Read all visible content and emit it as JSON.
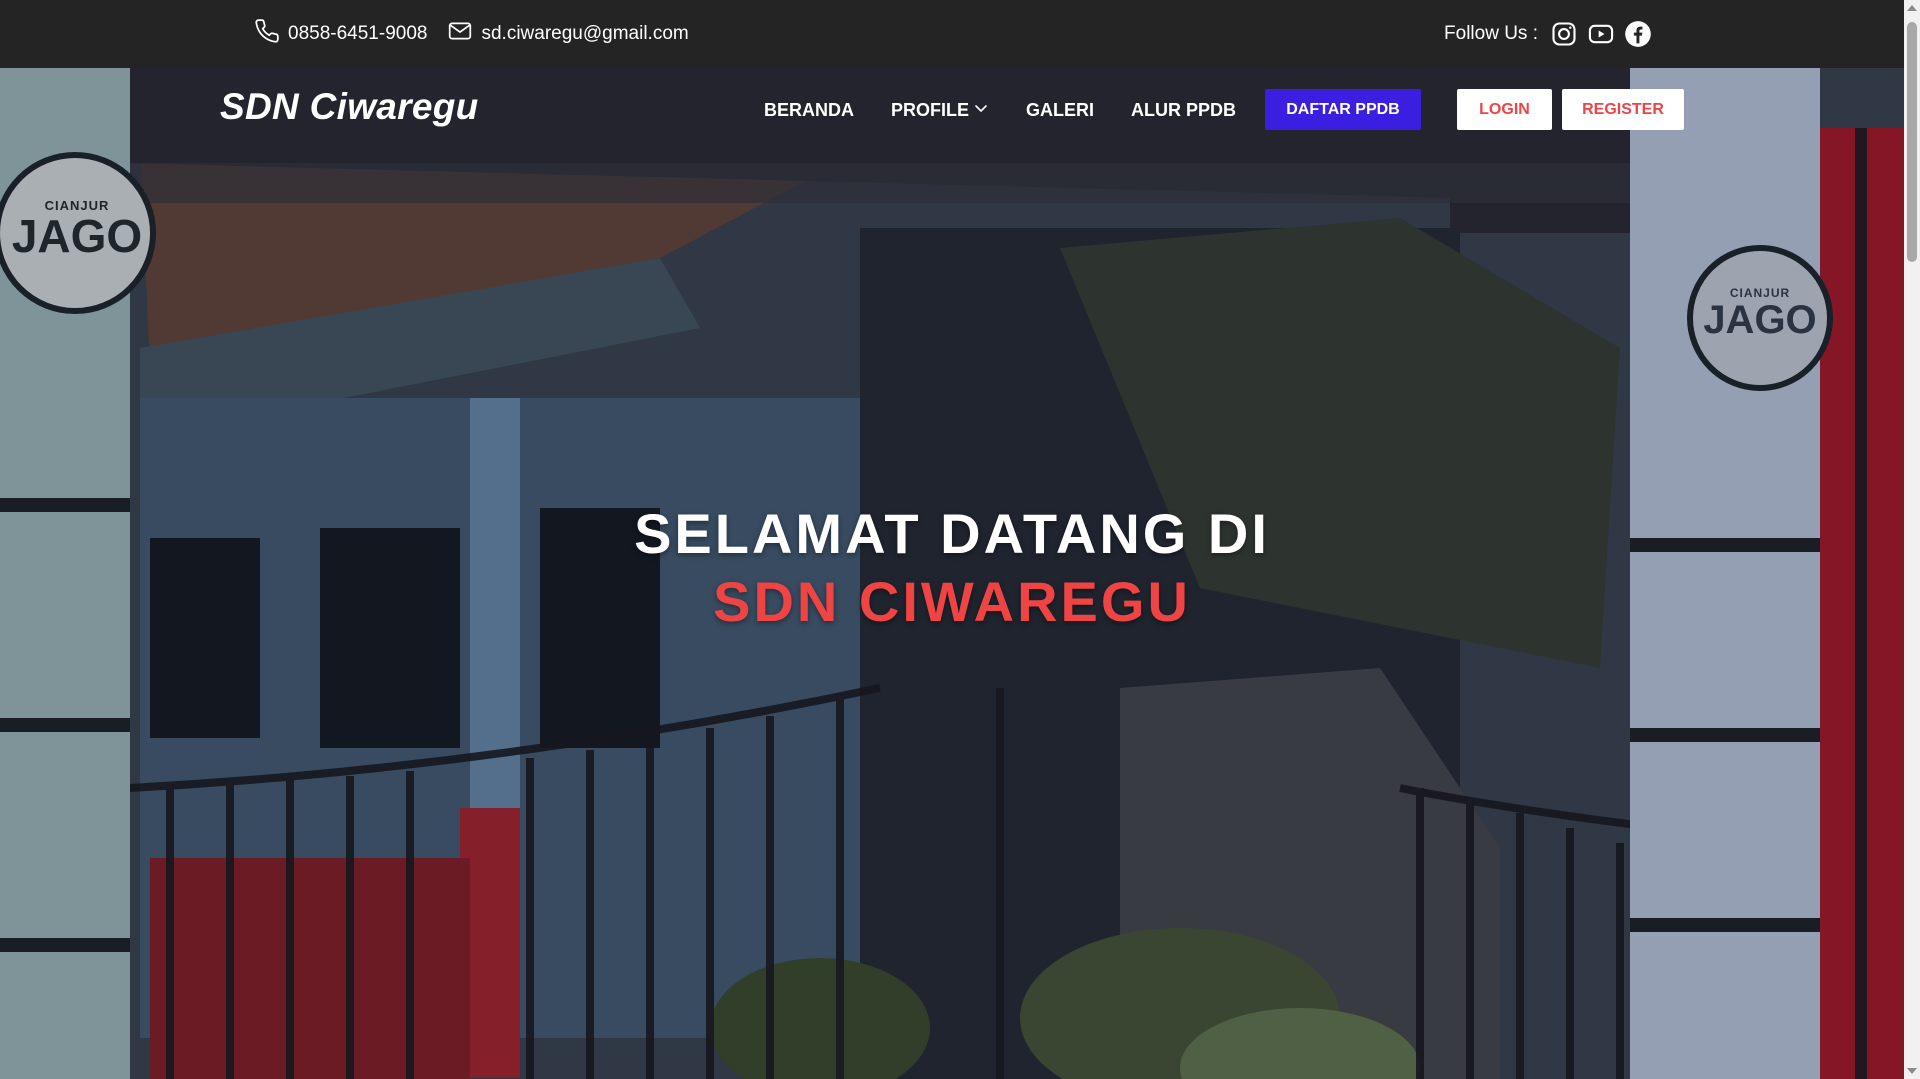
{
  "topbar": {
    "phone": "0858-6451-9008",
    "email": "sd.ciwaregu@gmail.com",
    "follow_label": "Follow Us :",
    "social_icons": [
      "instagram-icon",
      "youtube-icon",
      "facebook-icon"
    ]
  },
  "nav": {
    "brand": "SDN Ciwaregu",
    "menu": [
      {
        "label": "BERANDA"
      },
      {
        "label": "PROFILE",
        "has_dropdown": true
      },
      {
        "label": "GALERI"
      },
      {
        "label": "ALUR PPDB"
      }
    ],
    "daftar_label": "DAFTAR PPDB",
    "login_label": "LOGIN",
    "register_label": "REGISTER"
  },
  "hero": {
    "line1": "SELAMAT DATANG DI",
    "line2": "SDN CIWAREGU",
    "sign_text_top": "CIANJUR",
    "sign_text_main": "JAGO"
  },
  "colors": {
    "topbar_bg": "#242424",
    "accent_red": "#ef4444",
    "accent_blue": "#3b1fe0",
    "text_white": "#ffffff"
  }
}
